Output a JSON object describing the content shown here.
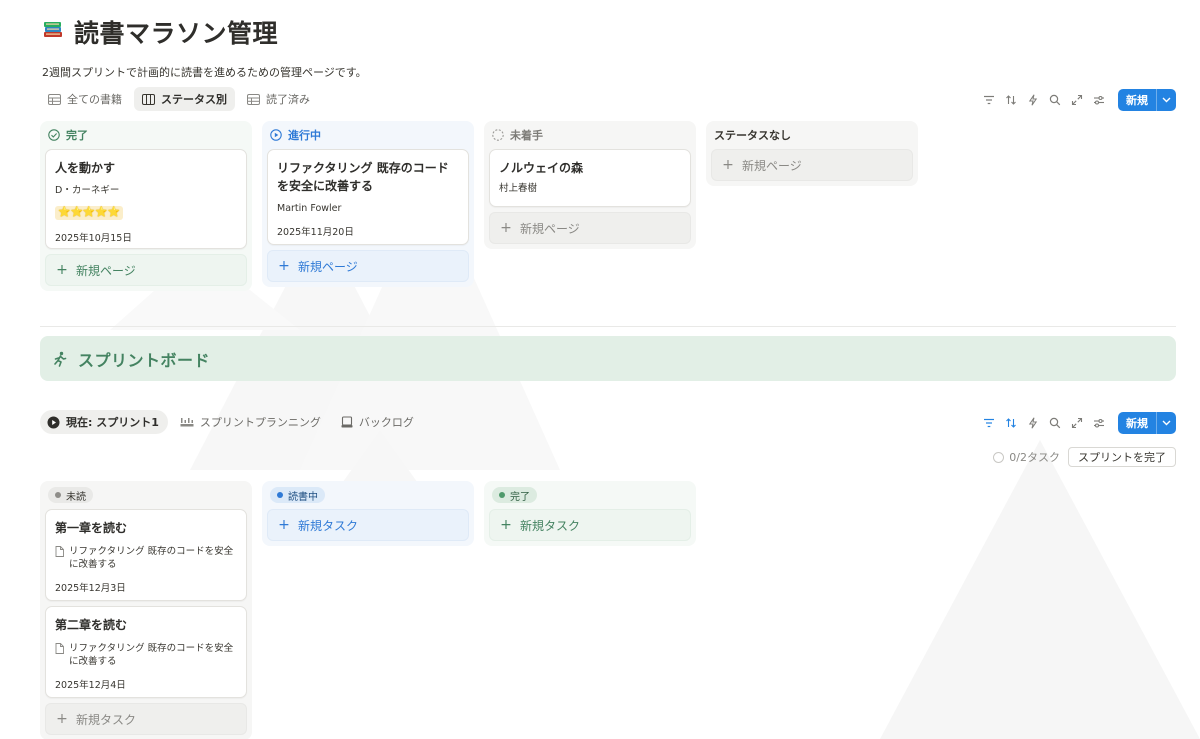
{
  "page": {
    "icon": "books-icon",
    "title": "読書マラソン管理",
    "description": "2週間スプリントで計画的に読書を進めるための管理ページです。"
  },
  "books": {
    "tabs": [
      {
        "label": "全ての書籍",
        "icon": "table-icon",
        "active": false
      },
      {
        "label": "ステータス別",
        "icon": "board-icon",
        "active": true
      },
      {
        "label": "読了済み",
        "icon": "table-icon",
        "active": false
      }
    ],
    "toolbar": {
      "new_label": "新規"
    },
    "columns": [
      {
        "label": "完了",
        "icon": "check-circle-icon",
        "cards": [
          {
            "title": "人を動かす",
            "author": "D・カーネギー",
            "rating": "⭐⭐⭐⭐⭐",
            "date": "2025年10月15日"
          }
        ],
        "add_label": "新規ページ"
      },
      {
        "label": "進行中",
        "icon": "play-circle-icon",
        "cards": [
          {
            "title": "リファクタリング 既存のコードを安全に改善する",
            "author": "Martin Fowler",
            "date": "2025年11月20日"
          }
        ],
        "add_label": "新規ページ"
      },
      {
        "label": "未着手",
        "icon": "dashed-circle-icon",
        "cards": [
          {
            "title": "ノルウェイの森",
            "author": "村上春樹"
          }
        ],
        "add_label": "新規ページ"
      },
      {
        "label": "ステータスなし",
        "cards": [],
        "add_label": "新規ページ"
      }
    ]
  },
  "callout": {
    "icon": "running-person-icon",
    "text": "スプリントボード"
  },
  "sprint": {
    "tabs": [
      {
        "label": "現在: スプリント1",
        "icon": "play-circle-filled-icon",
        "active": true
      },
      {
        "label": "スプリントプランニング",
        "icon": "timeline-icon",
        "active": false
      },
      {
        "label": "バックログ",
        "icon": "inbox-icon",
        "active": false
      }
    ],
    "toolbar": {
      "new_label": "新規"
    },
    "task_count": "0/2タスク",
    "complete_button": "スプリントを完了",
    "columns": [
      {
        "label": "未読",
        "cards": [
          {
            "title": "第一章を読む",
            "relation": "リファクタリング 既存のコードを安全に改善する",
            "date": "2025年12月3日"
          },
          {
            "title": "第二章を読む",
            "relation": "リファクタリング 既存のコードを安全に改善する",
            "date": "2025年12月4日"
          }
        ],
        "add_label": "新規タスク"
      },
      {
        "label": "読書中",
        "cards": [],
        "add_label": "新規タスク"
      },
      {
        "label": "完了",
        "cards": [],
        "add_label": "新規タスク"
      }
    ]
  },
  "colors": {
    "accent": "#2383e2",
    "green": "#448361",
    "blue": "#2f7ad6",
    "callout_bg": "#e2efe6"
  }
}
